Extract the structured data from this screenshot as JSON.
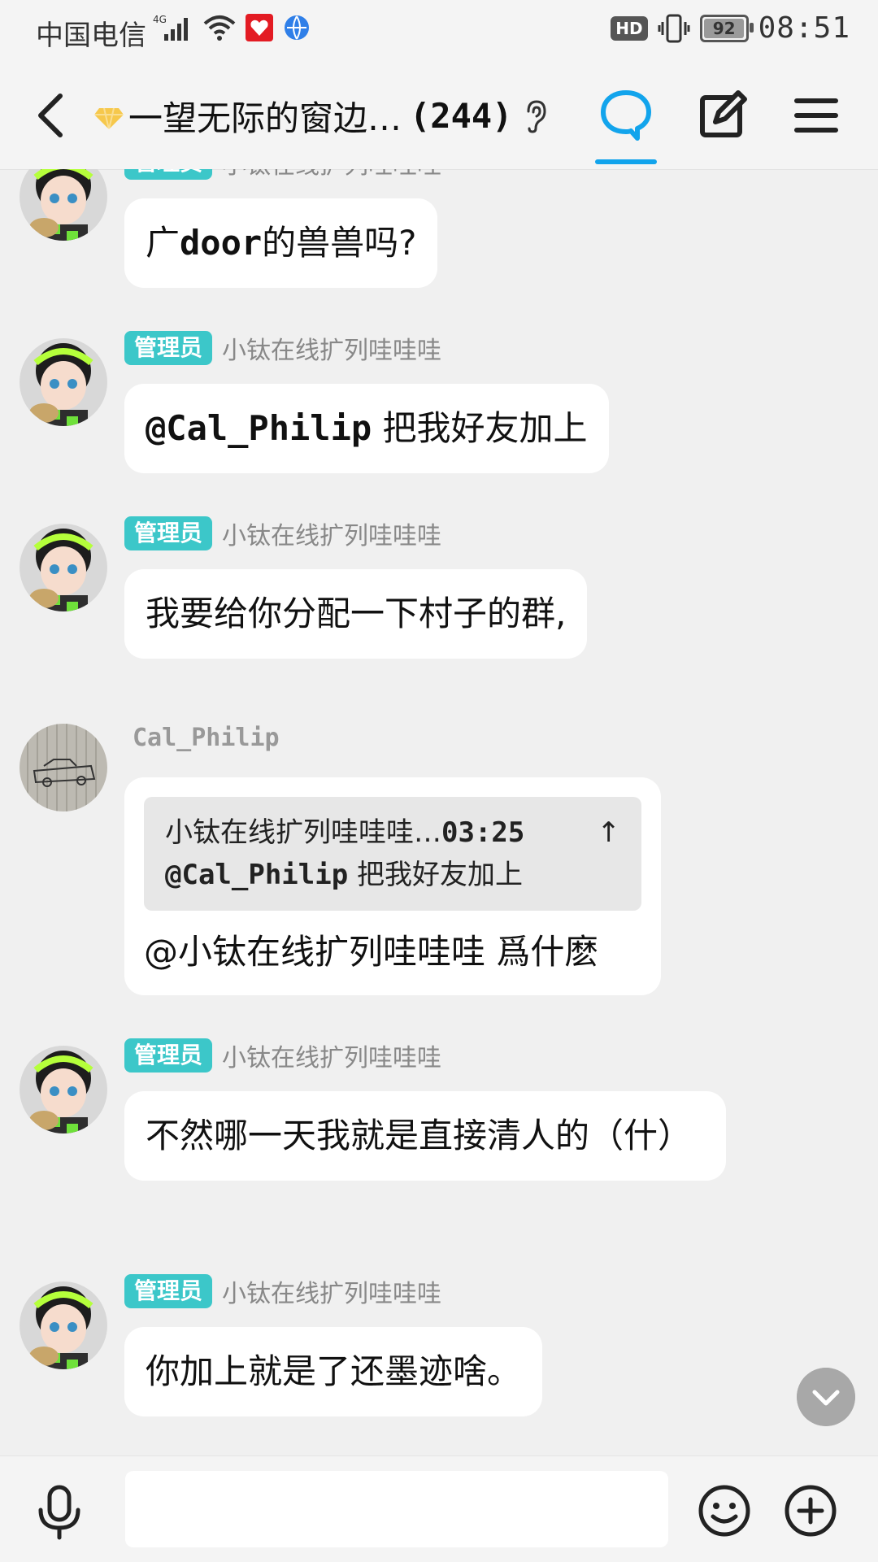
{
  "status_bar": {
    "carrier": "中国电信",
    "network": "4G",
    "hd_label": "HD",
    "battery_level": "92",
    "time": "08:51"
  },
  "header": {
    "title": "一望无际的窗边…",
    "member_count": "(244)",
    "icons": [
      "back-icon",
      "gem-icon",
      "ear-icon",
      "chat-bubble-icon",
      "edit-icon",
      "menu-icon"
    ],
    "accent_color": "#12a4ec"
  },
  "messages": [
    {
      "badge": "管理员",
      "sender": "小钛在线扩列哇哇哇",
      "text_parts": [
        "广",
        "door",
        "的兽兽吗?"
      ]
    },
    {
      "badge": "管理员",
      "sender": "小钛在线扩列哇哇哇",
      "mention": "@Cal_Philip",
      "text": " 把我好友加上"
    },
    {
      "badge": "管理员",
      "sender": "小钛在线扩列哇哇哇",
      "text": "我要给你分配一下村子的群,"
    },
    {
      "sender": "Cal_Philip",
      "quote": {
        "author": "小钛在线扩列哇哇哇…",
        "time": "03:25",
        "arrow": "↑",
        "mention": "@Cal_Philip",
        "text": " 把我好友加上"
      },
      "text": "@小钛在线扩列哇哇哇  爲什麽"
    },
    {
      "badge": "管理员",
      "sender": "小钛在线扩列哇哇哇",
      "text": "不然哪一天我就是直接清人的（什）"
    },
    {
      "badge": "管理员",
      "sender": "小钛在线扩列哇哇哇",
      "text": "你加上就是了还墨迹啥。"
    }
  ],
  "input": {
    "placeholder": ""
  },
  "colors": {
    "admin_badge": "#3cc7c9",
    "background": "#f0f0f0",
    "bubble": "#ffffff"
  }
}
